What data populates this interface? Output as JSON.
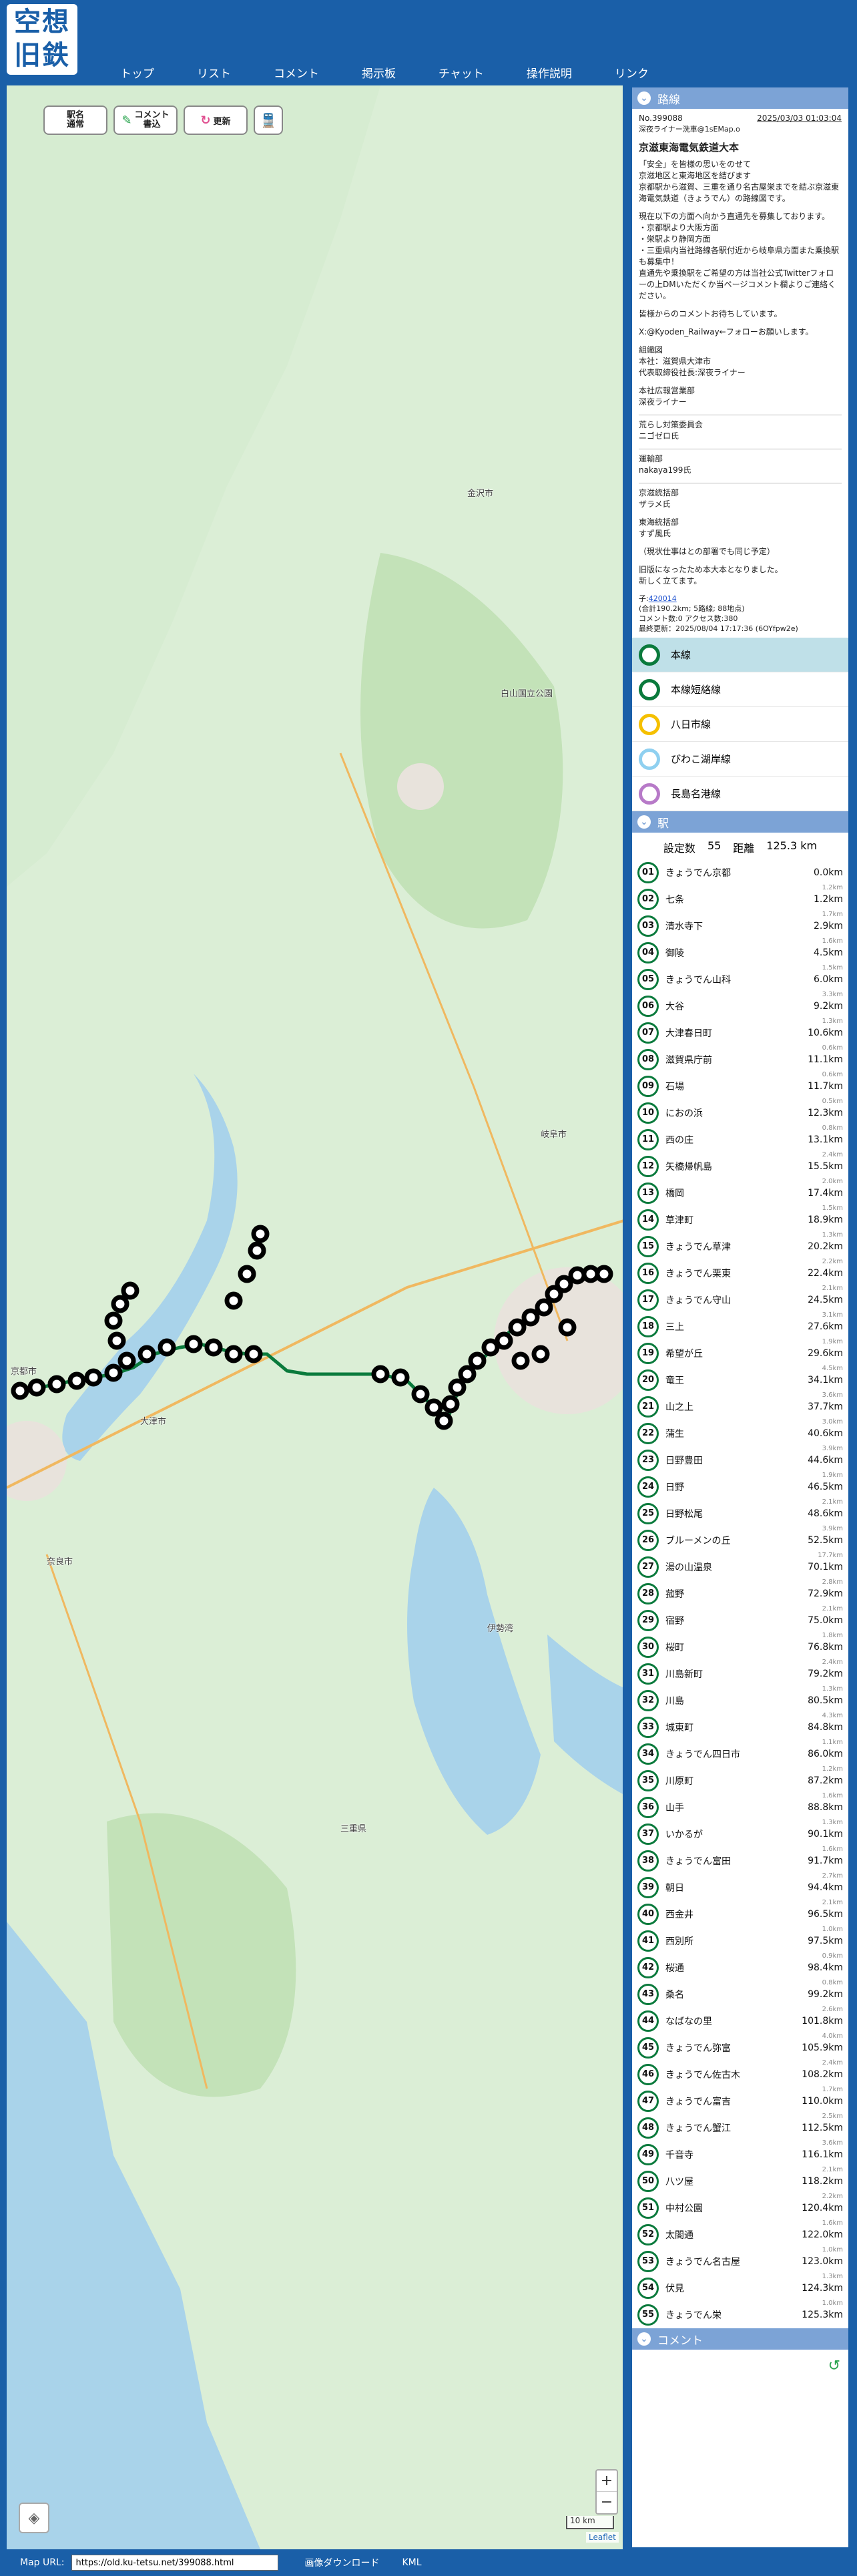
{
  "header": {
    "logo_line1": "空想",
    "logo_line2": "旧鉄",
    "nav": [
      "トップ",
      "リスト",
      "コメント",
      "掲示板",
      "チャット",
      "操作説明",
      "リンク"
    ]
  },
  "map": {
    "buttons": {
      "station_mode": "駅名\n通常",
      "comment": "コメント\n書込",
      "refresh": "更新"
    },
    "labels": [
      "金沢市",
      "白山国立公園",
      "岐阜市",
      "京都市",
      "奈良市",
      "大津市",
      "伊勢湾",
      "三重県"
    ],
    "zoom_in": "+",
    "zoom_out": "−",
    "scale": "10 km",
    "attribution": "Leaflet"
  },
  "panel": {
    "route_header": "路線",
    "no": "No.399088",
    "date": "2025/03/03 01:03:04",
    "author": "深夜ライナー洗車@1sEMap.o",
    "title": "京滋東海電気鉄道大本",
    "intro": "「安全」を皆様の思いをのせて\n京滋地区と東海地区を結びます\n京都駅から滋賀、三重を通り名古屋栄までを結ぶ京滋東海電気鉄道（きょうでん）の路線図です。",
    "recruit": "現在以下の方面へ向かう直通先を募集しております。\n・京都駅より大阪方面\n・栄駅より静岡方面\n・三重県内当社路線各駅付近から岐阜県方面また乗換駅も募集中！\n直通先や乗換駅をご希望の方は当社公式Twitterフォローの上DMいただくか当ページコメント欄よりご連絡ください。",
    "welcome": "皆様からのコメントお待ちしています。",
    "twitter": "X:@Kyoden_Railway←フォローお願いします。",
    "org": "組織図\n本社：滋賀県大津市\n代表取締役社長:深夜ライナー",
    "pr": "本社広報営業部\n深夜ライナー",
    "countermeasure": "荒らし対策委員会\nニゴゼロ氏",
    "ops": "運輸部\nnakaya199氏",
    "kyoshiga": "京滋統括部\nザラメ氏",
    "tokai": "東海統括部\nすず風氏",
    "note": "（現状仕事はとの部署でも同じ予定）",
    "note2": "旧版になったため本大本となりました。\n新しく立てます。",
    "child_label": "子:",
    "child_link": "420014",
    "stats": "(合計190.2km; 5路線; 88地点)",
    "stats2": "コメント数:0 アクセス数:380",
    "updated": "最終更新：2025/08/04 17:17:36 (6OYfpw2e)",
    "lines": [
      {
        "name": "本線",
        "color": "#0a7a3c"
      },
      {
        "name": "本線短絡線",
        "color": "#0a7a3c"
      },
      {
        "name": "八日市線",
        "color": "#f5c000"
      },
      {
        "name": "びわこ湖岸線",
        "color": "#8fd0f0"
      },
      {
        "name": "長島名港線",
        "color": "#b77ac8"
      }
    ],
    "station_header": "駅",
    "station_count_label": "設定数",
    "station_count": "55",
    "distance_label": "距離",
    "distance": "125.3 km",
    "comment_header": "コメント"
  },
  "stations": [
    {
      "n": "01",
      "name": "きょうでん京都",
      "km": "0.0km",
      "gap": "1.2km"
    },
    {
      "n": "02",
      "name": "七条",
      "km": "1.2km",
      "gap": "1.7km"
    },
    {
      "n": "03",
      "name": "清水寺下",
      "km": "2.9km",
      "gap": "1.6km"
    },
    {
      "n": "04",
      "name": "御陵",
      "km": "4.5km",
      "gap": "1.5km"
    },
    {
      "n": "05",
      "name": "きょうでん山科",
      "km": "6.0km",
      "gap": "3.3km"
    },
    {
      "n": "06",
      "name": "大谷",
      "km": "9.2km",
      "gap": "1.3km"
    },
    {
      "n": "07",
      "name": "大津春日町",
      "km": "10.6km",
      "gap": "0.6km"
    },
    {
      "n": "08",
      "name": "滋賀県庁前",
      "km": "11.1km",
      "gap": "0.6km"
    },
    {
      "n": "09",
      "name": "石場",
      "km": "11.7km",
      "gap": "0.5km"
    },
    {
      "n": "10",
      "name": "におの浜",
      "km": "12.3km",
      "gap": "0.8km"
    },
    {
      "n": "11",
      "name": "西の庄",
      "km": "13.1km",
      "gap": "2.4km"
    },
    {
      "n": "12",
      "name": "矢橋帰帆島",
      "km": "15.5km",
      "gap": "2.0km"
    },
    {
      "n": "13",
      "name": "橋岡",
      "km": "17.4km",
      "gap": "1.5km"
    },
    {
      "n": "14",
      "name": "草津町",
      "km": "18.9km",
      "gap": "1.3km"
    },
    {
      "n": "15",
      "name": "きょうでん草津",
      "km": "20.2km",
      "gap": "2.2km"
    },
    {
      "n": "16",
      "name": "きょうでん栗東",
      "km": "22.4km",
      "gap": "2.1km"
    },
    {
      "n": "17",
      "name": "きょうでん守山",
      "km": "24.5km",
      "gap": "3.1km"
    },
    {
      "n": "18",
      "name": "三上",
      "km": "27.6km",
      "gap": "1.9km"
    },
    {
      "n": "19",
      "name": "希望が丘",
      "km": "29.6km",
      "gap": "4.5km"
    },
    {
      "n": "20",
      "name": "竜王",
      "km": "34.1km",
      "gap": "3.6km"
    },
    {
      "n": "21",
      "name": "山之上",
      "km": "37.7km",
      "gap": "3.0km"
    },
    {
      "n": "22",
      "name": "蒲生",
      "km": "40.6km",
      "gap": "3.9km"
    },
    {
      "n": "23",
      "name": "日野豊田",
      "km": "44.6km",
      "gap": "1.9km"
    },
    {
      "n": "24",
      "name": "日野",
      "km": "46.5km",
      "gap": "2.1km"
    },
    {
      "n": "25",
      "name": "日野松尾",
      "km": "48.6km",
      "gap": "3.9km"
    },
    {
      "n": "26",
      "name": "ブルーメンの丘",
      "km": "52.5km",
      "gap": "17.7km"
    },
    {
      "n": "27",
      "name": "湯の山温泉",
      "km": "70.1km",
      "gap": "2.8km"
    },
    {
      "n": "28",
      "name": "菰野",
      "km": "72.9km",
      "gap": "2.1km"
    },
    {
      "n": "29",
      "name": "宿野",
      "km": "75.0km",
      "gap": "1.8km"
    },
    {
      "n": "30",
      "name": "桜町",
      "km": "76.8km",
      "gap": "2.4km"
    },
    {
      "n": "31",
      "name": "川島新町",
      "km": "79.2km",
      "gap": "1.3km"
    },
    {
      "n": "32",
      "name": "川島",
      "km": "80.5km",
      "gap": "4.3km"
    },
    {
      "n": "33",
      "name": "城東町",
      "km": "84.8km",
      "gap": "1.1km"
    },
    {
      "n": "34",
      "name": "きょうでん四日市",
      "km": "86.0km",
      "gap": "1.2km"
    },
    {
      "n": "35",
      "name": "川原町",
      "km": "87.2km",
      "gap": "1.6km"
    },
    {
      "n": "36",
      "name": "山手",
      "km": "88.8km",
      "gap": "1.3km"
    },
    {
      "n": "37",
      "name": "いかるが",
      "km": "90.1km",
      "gap": "1.6km"
    },
    {
      "n": "38",
      "name": "きょうでん富田",
      "km": "91.7km",
      "gap": "2.7km"
    },
    {
      "n": "39",
      "name": "朝日",
      "km": "94.4km",
      "gap": "2.1km"
    },
    {
      "n": "40",
      "name": "西金井",
      "km": "96.5km",
      "gap": "1.0km"
    },
    {
      "n": "41",
      "name": "西別所",
      "km": "97.5km",
      "gap": "0.9km"
    },
    {
      "n": "42",
      "name": "桜通",
      "km": "98.4km",
      "gap": "0.8km"
    },
    {
      "n": "43",
      "name": "桑名",
      "km": "99.2km",
      "gap": "2.6km"
    },
    {
      "n": "44",
      "name": "なばなの里",
      "km": "101.8km",
      "gap": "4.0km"
    },
    {
      "n": "45",
      "name": "きょうでん弥富",
      "km": "105.9km",
      "gap": "2.4km"
    },
    {
      "n": "46",
      "name": "きょうでん佐古木",
      "km": "108.2km",
      "gap": "1.7km"
    },
    {
      "n": "47",
      "name": "きょうでん富吉",
      "km": "110.0km",
      "gap": "2.5km"
    },
    {
      "n": "48",
      "name": "きょうでん蟹江",
      "km": "112.5km",
      "gap": "3.6km"
    },
    {
      "n": "49",
      "name": "千音寺",
      "km": "116.1km",
      "gap": "2.1km"
    },
    {
      "n": "50",
      "name": "八ツ屋",
      "km": "118.2km",
      "gap": "2.2km"
    },
    {
      "n": "51",
      "name": "中村公園",
      "km": "120.4km",
      "gap": "1.6km"
    },
    {
      "n": "52",
      "name": "太閤通",
      "km": "122.0km",
      "gap": "1.0km"
    },
    {
      "n": "53",
      "name": "きょうでん名古屋",
      "km": "123.0km",
      "gap": "1.3km"
    },
    {
      "n": "54",
      "name": "伏見",
      "km": "124.3km",
      "gap": "1.0km"
    },
    {
      "n": "55",
      "name": "きょうでん栄",
      "km": "125.3km",
      "gap": ""
    }
  ],
  "footer": {
    "map_url_label": "Map URL:",
    "map_url": "https://old.ku-tetsu.net/399088.html",
    "download": "画像ダウンロード",
    "kml": "KML"
  },
  "colors": {
    "brand": "#1a5fa8",
    "line_main": "#0a7a3c",
    "panel_header": "#7ca3d6",
    "selected_row": "#bfe0e8"
  }
}
